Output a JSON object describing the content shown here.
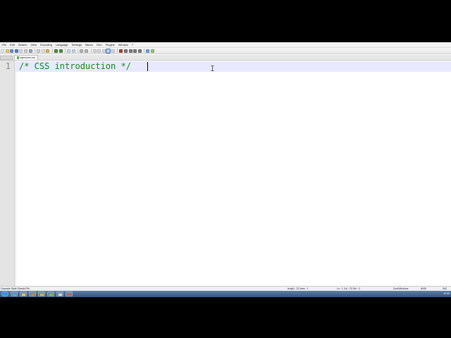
{
  "menu": {
    "items": [
      "File",
      "Edit",
      "Search",
      "View",
      "Encoding",
      "Language",
      "Settings",
      "Macro",
      "Run",
      "Plugins",
      "Window",
      "?"
    ]
  },
  "tab": {
    "label": "stylesheet.css"
  },
  "editor": {
    "line_number": "1",
    "code": "/* CSS introduction */"
  },
  "status": {
    "filetype": "Cascade Style Sheets File",
    "length": "length : 22    lines : 1",
    "position": "Ln : 1    Col : 23    Sel : 0",
    "eol": "Dos\\Windows",
    "encoding": "ANSI",
    "mode": "INS"
  },
  "taskbar": {
    "apps": [
      "start-orb",
      "internet-explorer",
      "windows-explorer",
      "media-player",
      "folder",
      "notepad-plus-plus",
      "browser",
      "paint"
    ],
    "clock": "12:00"
  },
  "colors": {
    "comment_text": "#108a10",
    "current_line": "#e8e8ff",
    "gutter": "#e4e4e4"
  }
}
